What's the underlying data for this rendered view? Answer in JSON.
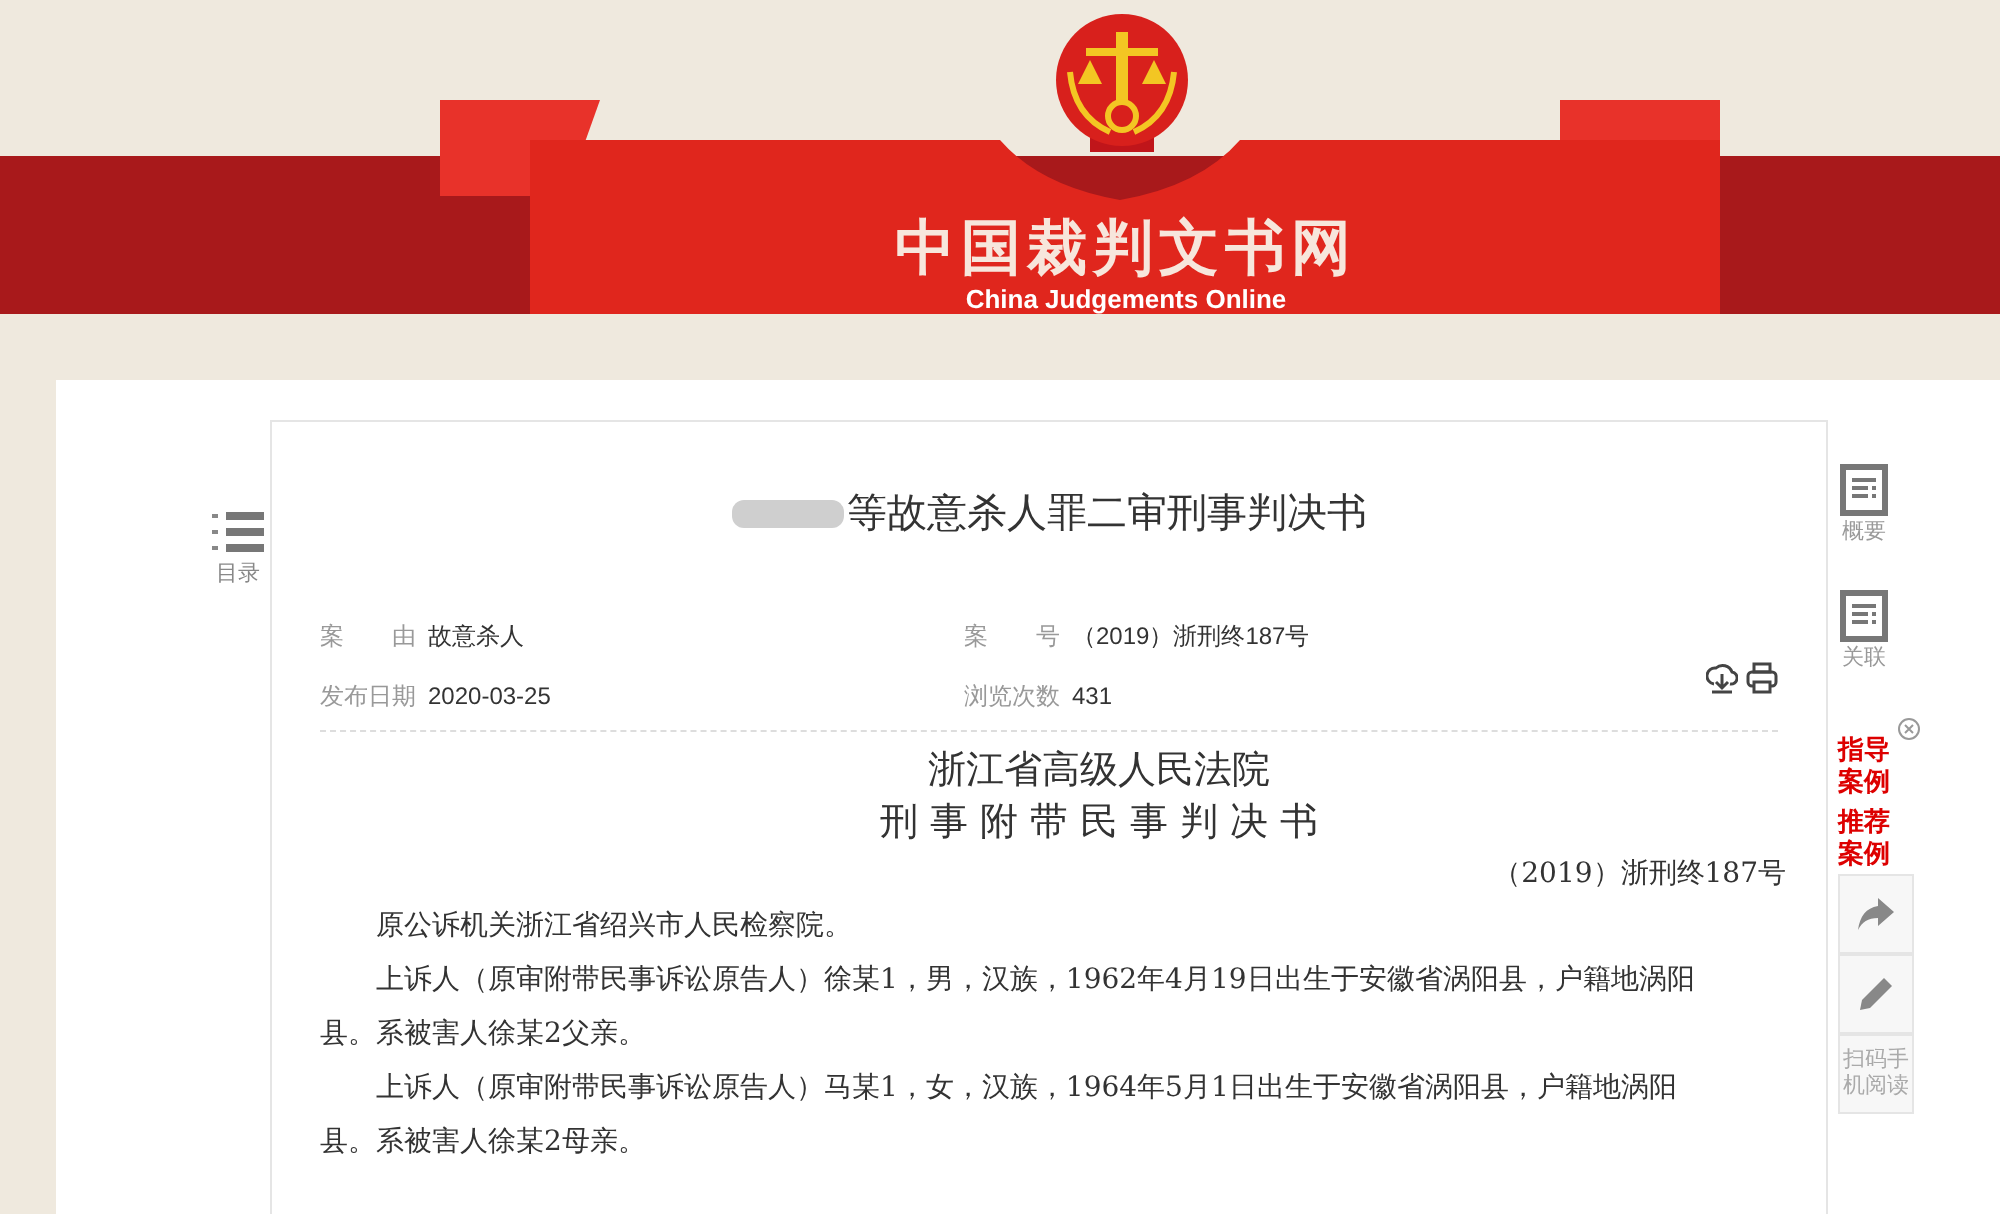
{
  "header": {
    "title": "中国裁判文书网",
    "subtitle": "China Judgements Online"
  },
  "toc": {
    "label": "目录"
  },
  "document": {
    "redacted_prefix": true,
    "title": "等故意杀人罪二审刑事判决书",
    "meta": [
      {
        "label": "案　　由",
        "value": "故意杀人"
      },
      {
        "label": "案　　号",
        "value": "（2019）浙刑终187号"
      },
      {
        "label": "发布日期",
        "value": "2020-03-25"
      },
      {
        "label": "浏览次数",
        "value": "431"
      }
    ],
    "court": "浙江省高级人民法院",
    "doc_type": "刑 事 附 带 民 事 判 决 书",
    "case_no": "（2019）浙刑终187号",
    "paragraphs": [
      "原公诉机关浙江省绍兴市人民检察院。",
      "上诉人（原审附带民事诉讼原告人）徐某1，男，汉族，1962年4月19日出生于安徽省涡阳县，户籍地涡阳县。系被害人徐某2父亲。",
      "上诉人（原审附带民事诉讼原告人）马某1，女，汉族，1964年5月1日出生于安徽省涡阳县，户籍地涡阳县。系被害人徐某2母亲。"
    ]
  },
  "right_sidebar": {
    "panels": [
      {
        "label": "概要"
      },
      {
        "label": "关联"
      }
    ],
    "case_links": [
      "指导案例",
      "推荐案例"
    ],
    "tools": [
      {
        "kind": "share"
      },
      {
        "kind": "edit"
      },
      {
        "kind": "text",
        "label": "扫码手机阅读"
      }
    ]
  }
}
